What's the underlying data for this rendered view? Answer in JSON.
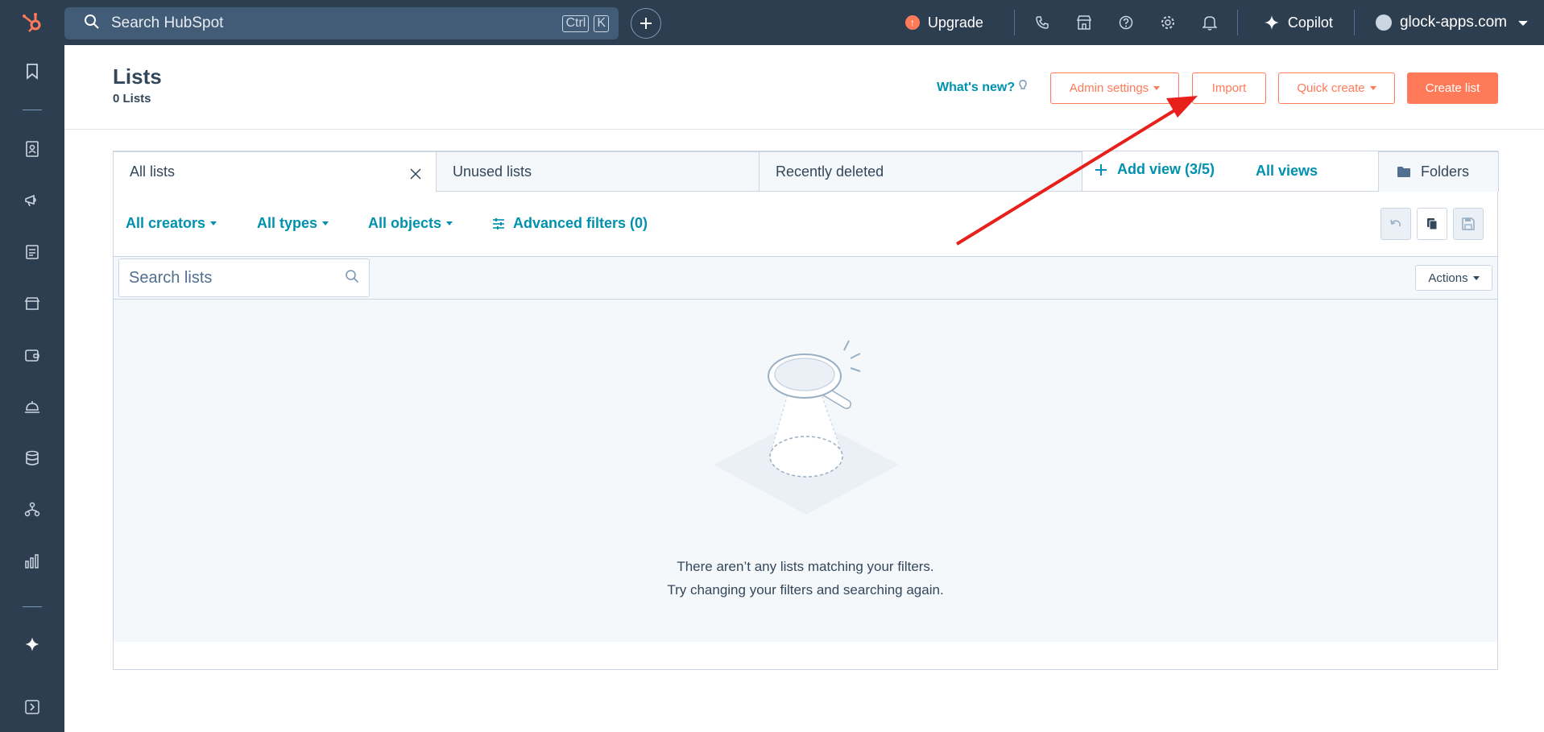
{
  "topnav": {
    "search_placeholder": "Search HubSpot",
    "shortcut_key1": "Ctrl",
    "shortcut_key2": "K",
    "upgrade_label": "Upgrade",
    "copilot_label": "Copilot",
    "account_name": "glock-apps.com"
  },
  "header": {
    "title": "Lists",
    "subtitle": "0 Lists",
    "whats_new": "What's new?",
    "admin_settings": "Admin settings",
    "import": "Import",
    "quick_create": "Quick create",
    "create_list": "Create list"
  },
  "tabs": {
    "all_lists": "All lists",
    "unused_lists": "Unused lists",
    "recently_deleted": "Recently deleted",
    "add_view": "Add view (3/5)",
    "all_views": "All views",
    "folders": "Folders"
  },
  "filters": {
    "all_creators": "All creators",
    "all_types": "All types",
    "all_objects": "All objects",
    "advanced_filters": "Advanced filters (0)"
  },
  "toolbar": {
    "search_placeholder": "Search lists",
    "actions": "Actions"
  },
  "empty_state": {
    "line1": "There aren’t any lists matching your filters.",
    "line2": "Try changing your filters and searching again."
  },
  "colors": {
    "nav_bg": "#2d3e50",
    "accent": "#ff7a59",
    "link": "#0091ae",
    "annotation_arrow": "#e8201c"
  }
}
